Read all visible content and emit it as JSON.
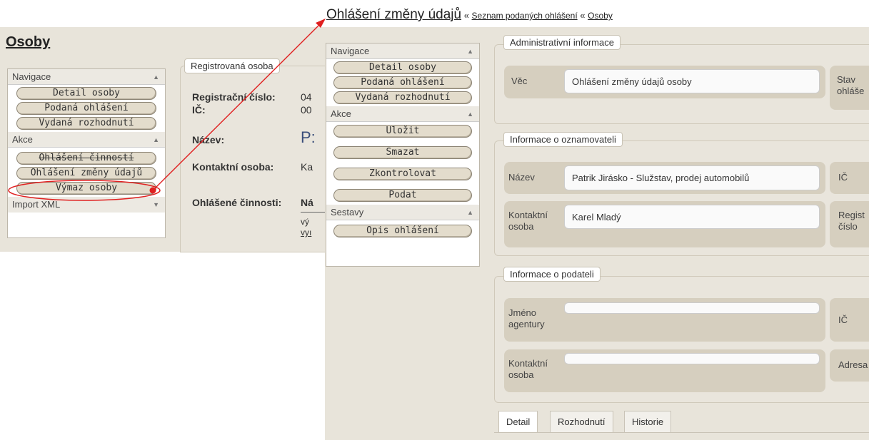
{
  "left": {
    "title": "Osoby",
    "nav_header": "Navigace",
    "nav_items": [
      "Detail osoby",
      "Podaná ohlášení",
      "Vydaná rozhodnutí"
    ],
    "actions_header": "Akce",
    "action_items": [
      "Ohlášení činností",
      "Ohlášení změny údajů",
      "Výmaz osoby"
    ],
    "import_header": "Import XML",
    "section_legend": "Registrovaná osoba",
    "fields": {
      "reg_label": "Registrační číslo:",
      "reg_value": "04",
      "ic_label": "IČ:",
      "ic_value": "00",
      "name_label": "Název:",
      "name_value": "P:",
      "contact_label": "Kontaktní osoba:",
      "contact_value": "Ka",
      "activities_label": "Ohlášené činnosti:",
      "activities_col": "Ná",
      "activities_row1": "vý",
      "activities_row2": "vyı"
    }
  },
  "right": {
    "title": "Ohlášení změny údajů",
    "sep1": "«",
    "crumb1": "Seznam podaných ohlášení",
    "sep2": "«",
    "crumb2": "Osoby",
    "nav_header": "Navigace",
    "nav_items": [
      "Detail osoby",
      "Podaná ohlášení",
      "Vydaná rozhodnutí"
    ],
    "actions_header": "Akce",
    "action_items": [
      "Uložit",
      "Smazat",
      "Zkontrolovat",
      "Podat"
    ],
    "reports_header": "Sestavy",
    "report_items": [
      "Opis ohlášení"
    ],
    "admin": {
      "legend": "Administrativní informace",
      "vec_label": "Věc",
      "vec_value": "Ohlášení změny údajů osoby",
      "stav_label": "Stav ohláše"
    },
    "oznamovatel": {
      "legend": "Informace o oznamovateli",
      "nazev_label": "Název",
      "nazev_value": "Patrik Jirásko - Služstav, prodej automobilů",
      "ic_label": "IČ",
      "kontakt_label": "Kontaktní osoba",
      "kontakt_value": "Karel Mladý",
      "regist_label": "Regist číslo"
    },
    "podatel": {
      "legend": "Informace o podateli",
      "jmeno_label": "Jméno agentury",
      "jmeno_value": "",
      "ic_label": "IČ",
      "kontakt_label": "Kontaktní osoba",
      "kontakt_value": "",
      "adresa_label": "Adresa"
    },
    "tabs": [
      "Detail",
      "Rozhodnutí",
      "Historie"
    ]
  },
  "colors": {
    "annotation": "#e02020"
  }
}
